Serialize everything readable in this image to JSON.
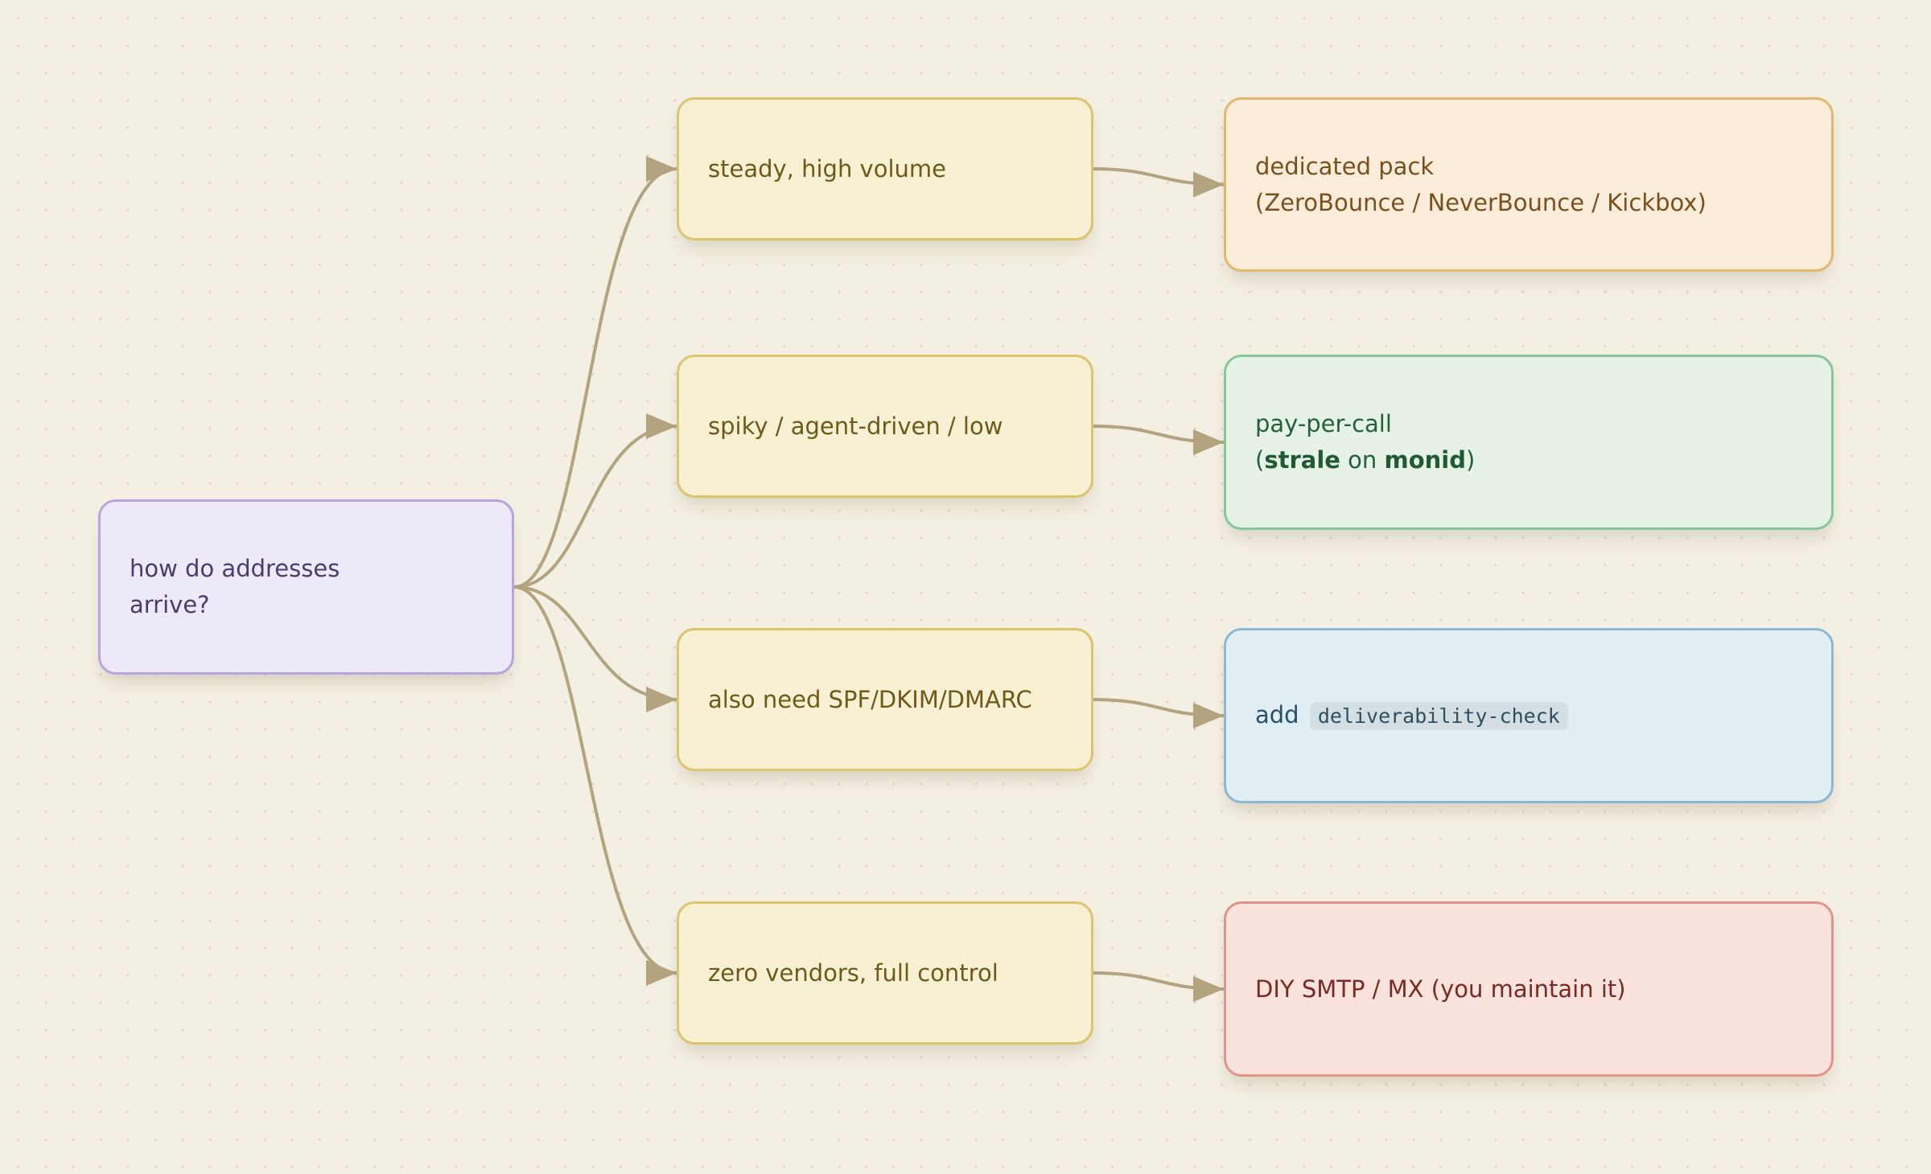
{
  "colors": {
    "background": "#f3efe3",
    "edge": "#b3a47f",
    "root_fill": "#ede9f8",
    "option_fill": "#f7f0d2",
    "result_orange": "#fbedda",
    "result_green": "#e6f2e6",
    "result_blue": "#e1eef3",
    "result_red": "#fae3dc"
  },
  "diagram": {
    "root": {
      "label": "how do addresses\narrive?"
    },
    "options": [
      {
        "label": "steady, high volume"
      },
      {
        "label": "spiky / agent-driven / low"
      },
      {
        "label": "also need SPF/DKIM/DMARC"
      },
      {
        "label": "zero vendors, full control"
      }
    ],
    "results": [
      {
        "line1": "dedicated pack",
        "line2": "(ZeroBounce / NeverBounce / Kickbox)"
      },
      {
        "line1": "pay-per-call",
        "open": "(",
        "bold1": "strale",
        "mid": " on ",
        "bold2": "monid",
        "close": ")"
      },
      {
        "prefix": "add",
        "code": "deliverability-check"
      },
      {
        "label": "DIY SMTP / MX (you maintain it)"
      }
    ]
  }
}
